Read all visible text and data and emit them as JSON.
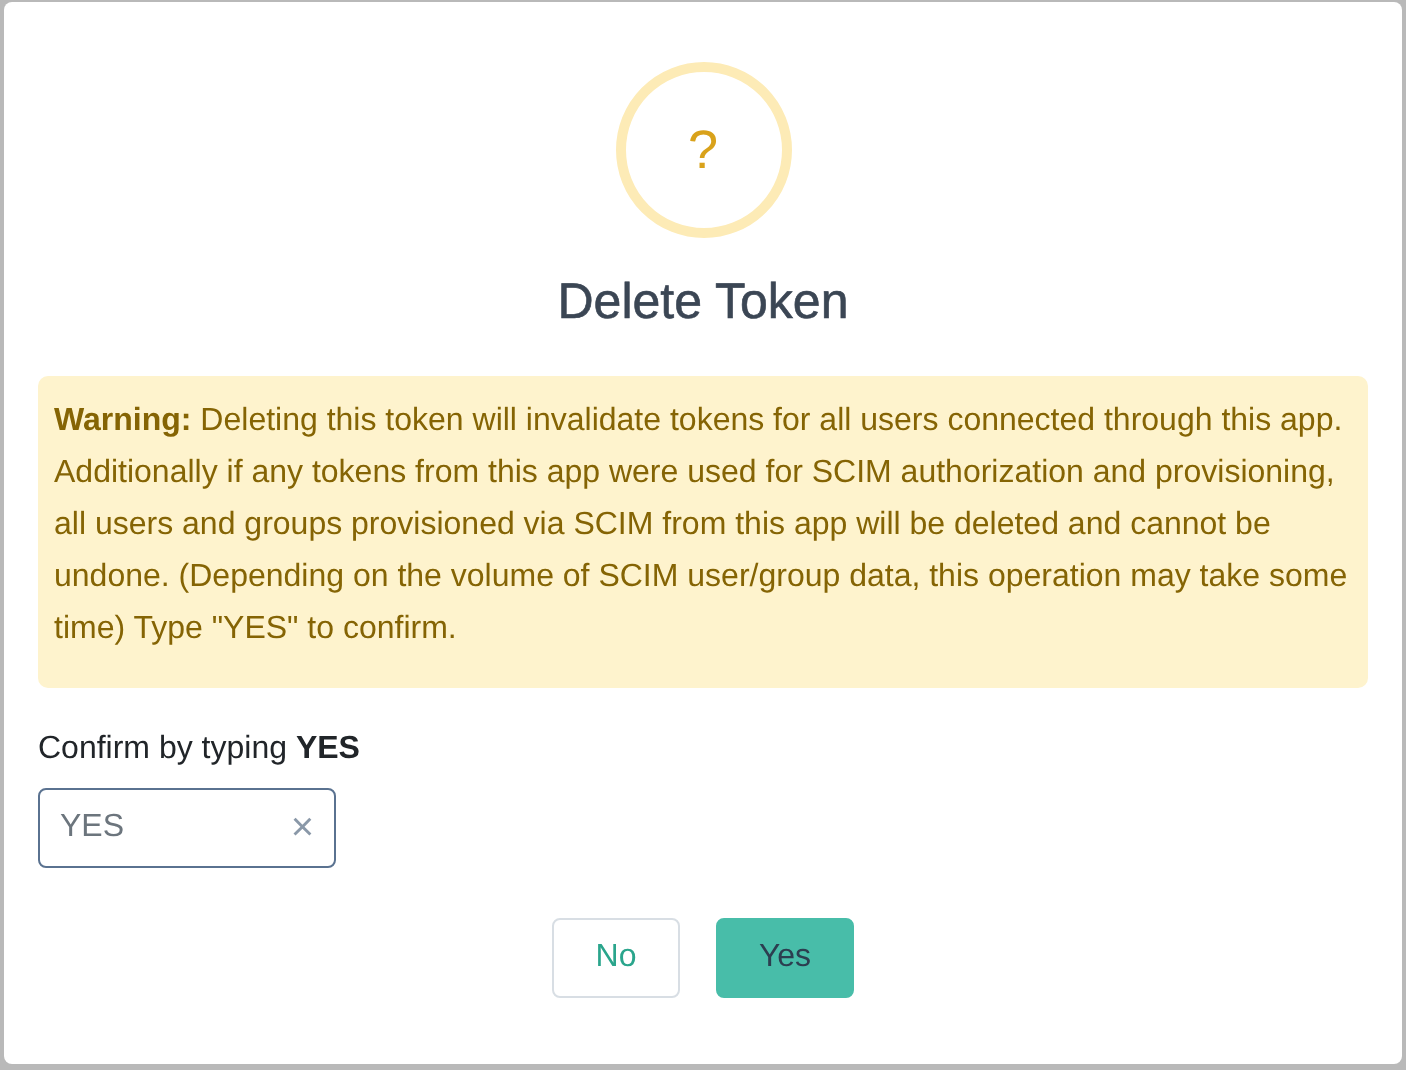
{
  "dialog": {
    "icon": "?",
    "title": "Delete Token",
    "warning": "**Warning:** Deleting this token will invalidate tokens for all users connected through this app. Additionally if any tokens from this app were used for SCIM authorization and provisioning, all users and groups provisioned via SCIM from this app will be deleted and cannot be undone. (Depending on the volume of SCIM user/group data, this operation may take some time) Type \"YES\" to confirm.",
    "confirm_label": "Confirm by typing **YES**",
    "confirm_field": {
      "value": "YES",
      "clear": "×"
    },
    "buttons": [
      {
        "label": "No",
        "kind": "secondary"
      },
      {
        "label": "Yes",
        "kind": "primary"
      }
    ]
  }
}
